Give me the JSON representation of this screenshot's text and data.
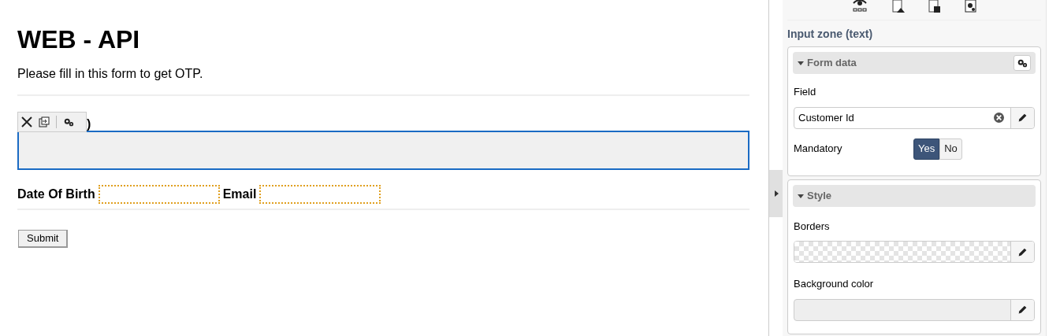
{
  "form": {
    "title": "WEB - API",
    "intro": "Please fill in this form to get OTP.",
    "selected_field_label": ")",
    "fields": [
      {
        "label": "Date Of Birth"
      },
      {
        "label": "Email"
      }
    ],
    "submit": "Submit"
  },
  "panel": {
    "title": "Input zone (text)",
    "sections": [
      {
        "kind": "form_data",
        "title": "Form data",
        "expanded": true,
        "field_label": "Field",
        "field_value": "Customer Id",
        "mandatory_label": "Mandatory",
        "mandatory_options": [
          {
            "label": "Yes",
            "selected": true
          },
          {
            "label": "No",
            "selected": false
          }
        ]
      },
      {
        "kind": "style",
        "title": "Style",
        "expanded": true,
        "borders_label": "Borders",
        "background_label": "Background color"
      }
    ]
  }
}
